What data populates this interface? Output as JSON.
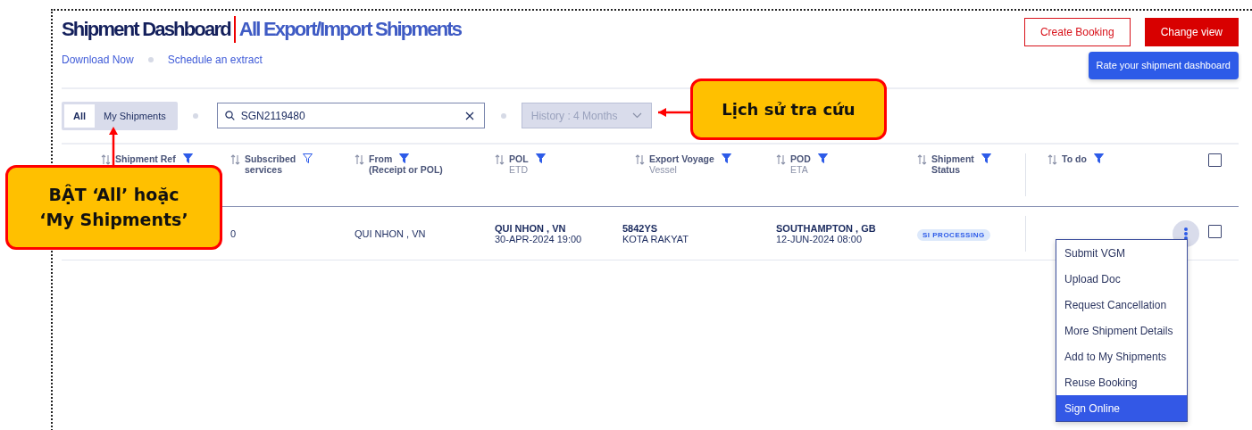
{
  "header": {
    "title": "Shipment Dashboard",
    "subtitle": "All Export/Import Shipments",
    "links": [
      "Download Now",
      "Schedule an extract"
    ],
    "buttons": [
      {
        "label": "Create Booking",
        "kind": "outline"
      },
      {
        "label": "Change view",
        "kind": "solid"
      }
    ],
    "rate_button": "Rate your shipment dashboard"
  },
  "filters": {
    "toggle": [
      {
        "label": "All",
        "selected": true
      },
      {
        "label": "My Shipments",
        "selected": false
      }
    ],
    "search": {
      "value": "SGN2119480"
    },
    "history": {
      "label": "History : 4 Months",
      "disabled": true
    }
  },
  "table": {
    "columns": [
      {
        "title": [
          "Shipment Ref"
        ],
        "filter_active": true
      },
      {
        "title": [
          "Subscribed",
          "services"
        ],
        "filter_active": false
      },
      {
        "title": [
          "From",
          "(Receipt or POL)"
        ],
        "filter_active": true
      },
      {
        "title": [
          "POL"
        ],
        "subtitle": "ETD",
        "filter_active": true
      },
      {
        "title": [
          "Export Voyage"
        ],
        "subtitle": "Vessel",
        "filter_active": true
      },
      {
        "title": [
          "POD"
        ],
        "subtitle": "ETA",
        "filter_active": true
      },
      {
        "title": [
          "Shipment",
          "Status"
        ],
        "filter_active": true
      },
      {
        "title": [
          "To do"
        ],
        "filter_active": true
      }
    ],
    "select_all": {
      "checked": false
    },
    "rows": [
      {
        "subscribed": "0",
        "from": "QUI NHON , VN",
        "pol": {
          "main": "QUI NHON , VN",
          "sub": "30-APR-2024 19:00"
        },
        "voyage": {
          "main": "5842YS",
          "sub": "KOTA RAKYAT"
        },
        "pod": {
          "main": "SOUTHAMPTON , GB",
          "sub": "12-JUN-2024 08:00"
        },
        "status": "SI PROCESSING",
        "checked": false
      }
    ]
  },
  "action_menu": {
    "items": [
      {
        "label": "Submit VGM",
        "selected": false
      },
      {
        "label": "Upload Doc",
        "selected": false
      },
      {
        "label": "Request Cancellation",
        "selected": false
      },
      {
        "label": "More Shipment Details",
        "selected": false
      },
      {
        "label": "Add to My Shipments",
        "selected": false
      },
      {
        "label": "Reuse Booking",
        "selected": false
      },
      {
        "label": "Sign Online",
        "selected": true
      }
    ]
  },
  "callouts": [
    {
      "text": "Lịch sử tra cứu"
    },
    {
      "text": "BẬT ‘All’ hoặc ‘My Shipments’"
    }
  ]
}
